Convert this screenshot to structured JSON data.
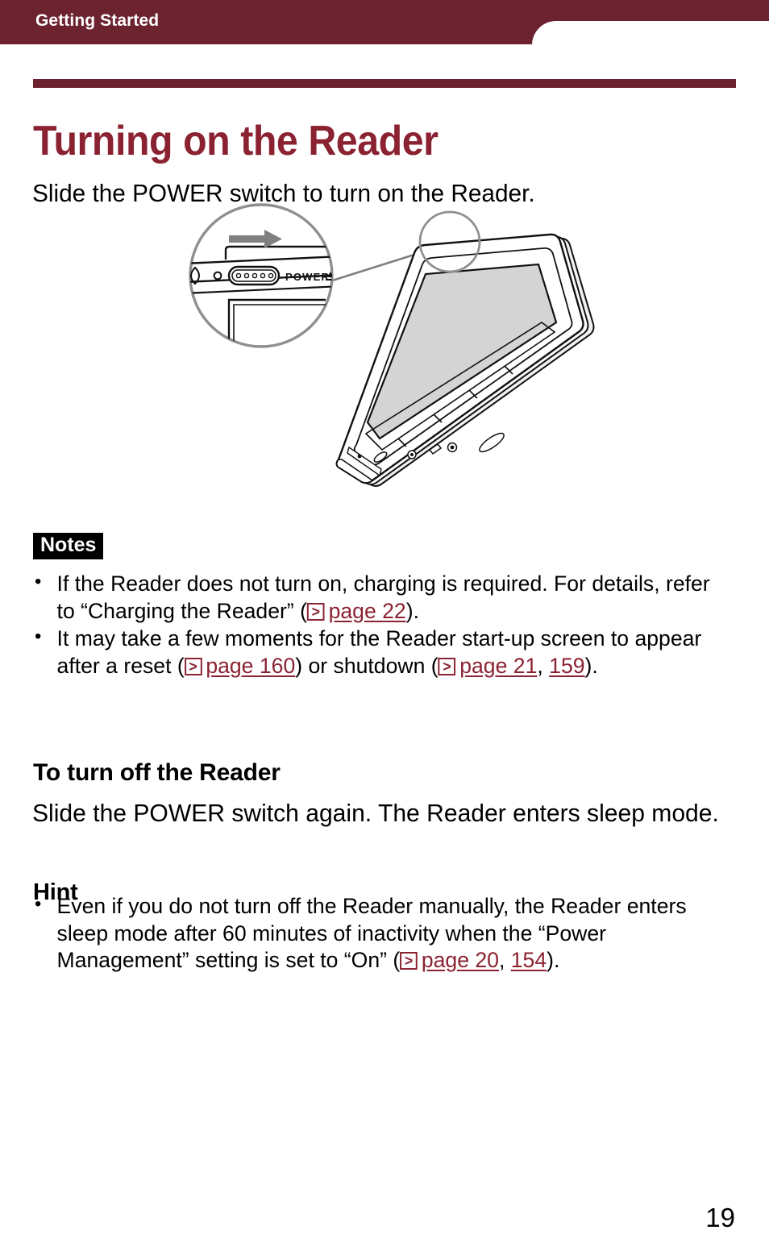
{
  "colors": {
    "brand_maroon": "#6d2230",
    "title_maroon": "#8b2231",
    "link_maroon": "#8b2231",
    "screen_gray": "#d4d4d4",
    "callout_gray": "#808080",
    "text_black": "#000000",
    "header_text": "#ffffff"
  },
  "header": {
    "running_title": "Getting Started"
  },
  "page_title": "Turning on the Reader",
  "lead_sentence": "Slide the POWER switch to turn on the Reader.",
  "figure": {
    "caption": "",
    "device_label": "POWER",
    "callout_name": "power-switch-detail-callout",
    "arrow_direction": "right",
    "icons": [
      "power-switch-icon",
      "slide-arrow-icon",
      "magnifier-callout-circle"
    ]
  },
  "notes": {
    "label": "Notes",
    "items": [
      {
        "parts": [
          {
            "type": "text",
            "value": "If the Reader does not turn on, charging is required. For details, refer to “Charging the Reader” ("
          },
          {
            "type": "pageref-icon"
          },
          {
            "type": "link",
            "value": "page 22"
          },
          {
            "type": "text",
            "value": ")."
          }
        ]
      },
      {
        "parts": [
          {
            "type": "text",
            "value": "It may take a few moments for the Reader start-up screen to appear after a reset ("
          },
          {
            "type": "pageref-icon"
          },
          {
            "type": "link",
            "value": "page 160"
          },
          {
            "type": "text",
            "value": ") or shutdown ("
          },
          {
            "type": "pageref-icon"
          },
          {
            "type": "link",
            "value": "page 21"
          },
          {
            "type": "text",
            "value": ", "
          },
          {
            "type": "link",
            "value": "159"
          },
          {
            "type": "text",
            "value": ")."
          }
        ]
      }
    ],
    "item1_text_a": "If the Reader does not turn on, charging is required. For details, refer to “Charging the Reader” (",
    "item1_link": "page 22",
    "item1_text_b": ").",
    "item2_text_a": "It may take a few moments for the Reader start-up screen to appear after a reset (",
    "item2_link_a": "page 160",
    "item2_text_b": ") or shutdown (",
    "item2_link_b": "page 21",
    "item2_text_c": ", ",
    "item2_link_c": "159",
    "item2_text_d": ")."
  },
  "turn_off_section": {
    "heading": "To turn off the Reader",
    "body": "Slide the POWER switch again. The Reader enters sleep mode."
  },
  "hint": {
    "label": "Hint",
    "item1_text_a": "Even if you do not turn off the Reader manually, the Reader enters sleep mode after 60 minutes of inactivity when the “Power Management” setting is set to “On” (",
    "item1_link_a": "page 20",
    "item1_text_b": ", ",
    "item1_link_b": "154",
    "item1_text_c": ")."
  },
  "folio": "19"
}
